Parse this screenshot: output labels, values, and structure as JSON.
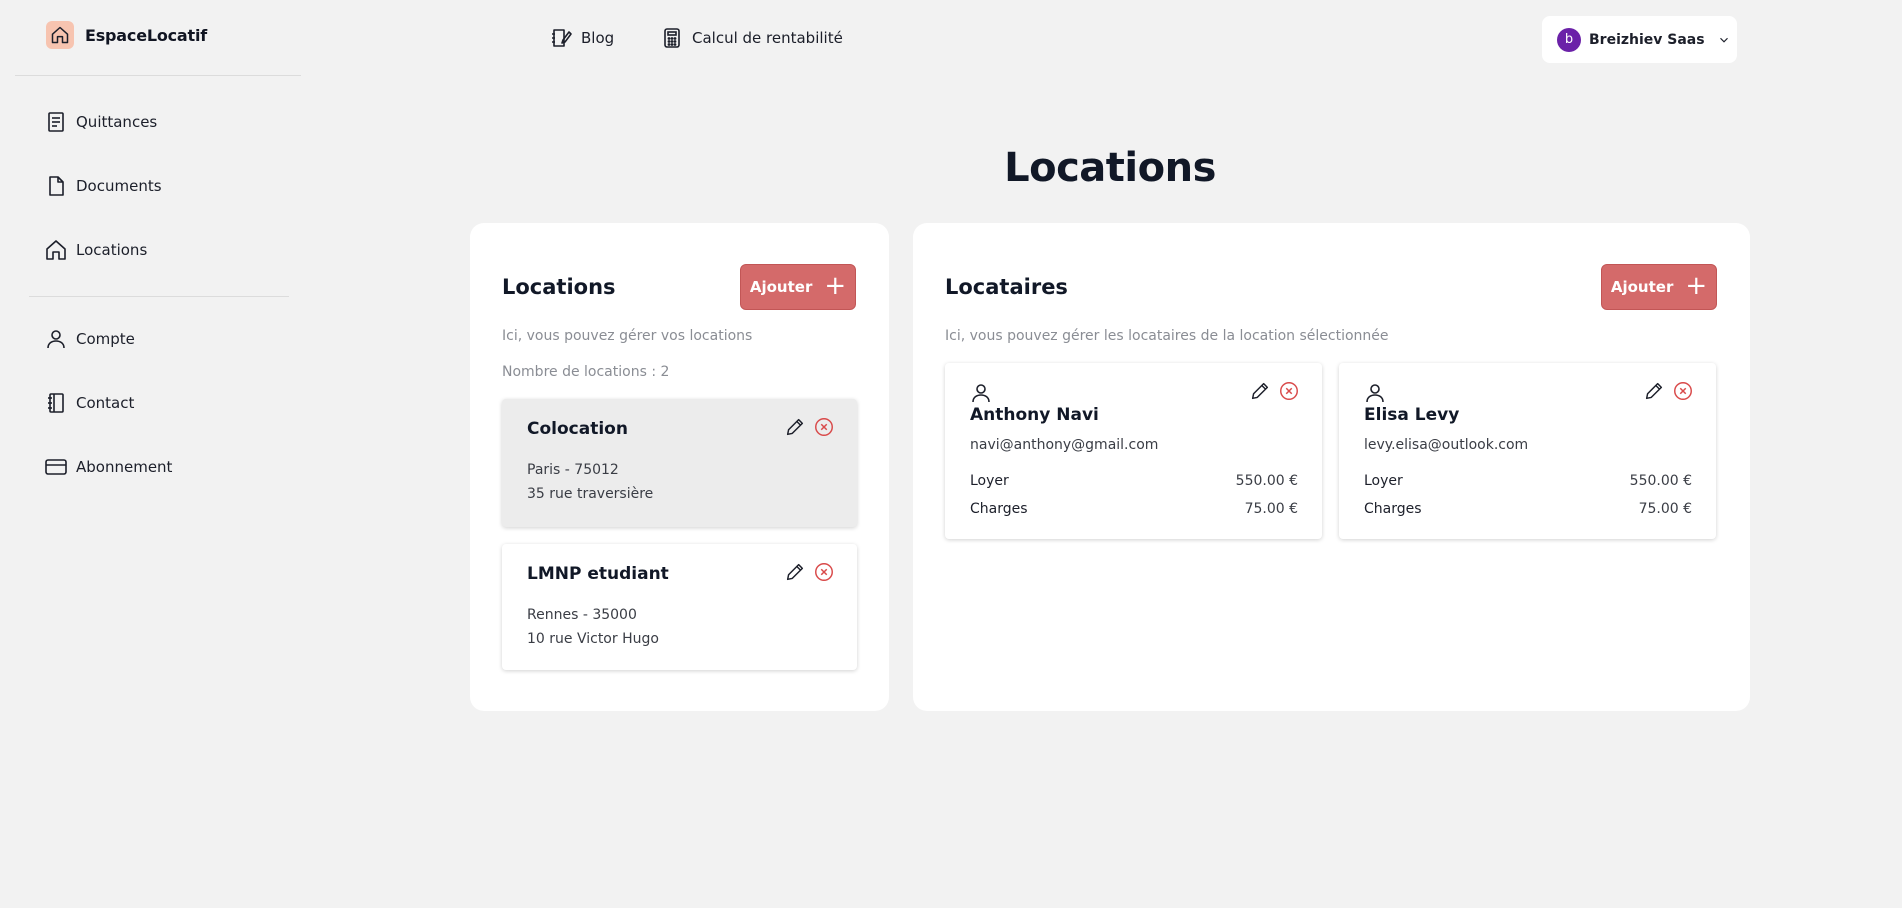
{
  "brand": {
    "name": "EspaceLocatif"
  },
  "sidebar": {
    "items": [
      {
        "label": "Quittances",
        "icon": "receipt-icon"
      },
      {
        "label": "Documents",
        "icon": "document-icon"
      },
      {
        "label": "Locations",
        "icon": "home-icon"
      },
      {
        "label": "Compte",
        "icon": "user-icon"
      },
      {
        "label": "Contact",
        "icon": "contact-book-icon"
      },
      {
        "label": "Abonnement",
        "icon": "credit-card-icon"
      }
    ]
  },
  "topnav": {
    "blog": "Blog",
    "calc": "Calcul de rentabilité"
  },
  "user": {
    "initial": "b",
    "name": "Breizhiev Saas"
  },
  "page": {
    "title": "Locations"
  },
  "locations_panel": {
    "heading": "Locations",
    "add_label": "Ajouter",
    "description": "Ici, vous pouvez gérer vos locations",
    "count_text": "Nombre de locations : 2",
    "items": [
      {
        "name": "Colocation",
        "city": "Paris - 75012",
        "street": "35 rue traversière",
        "selected": true
      },
      {
        "name": "LMNP etudiant",
        "city": "Rennes - 35000",
        "street": "10 rue Victor Hugo",
        "selected": false
      }
    ]
  },
  "tenants_panel": {
    "heading": "Locataires",
    "add_label": "Ajouter",
    "description": "Ici, vous pouvez gérer les locataires de la location sélectionnée",
    "rent_label": "Loyer",
    "charges_label": "Charges",
    "items": [
      {
        "name": "Anthony Navi",
        "email": "navi@anthony@gmail.com",
        "rent": "550.00 €",
        "charges": "75.00 €"
      },
      {
        "name": "Elisa Levy",
        "email": "levy.elisa@outlook.com",
        "rent": "550.00 €",
        "charges": "75.00 €"
      }
    ]
  },
  "colors": {
    "accent": "#d46a6a",
    "avatar": "#6b21a8",
    "delete": "#d94a4a"
  }
}
